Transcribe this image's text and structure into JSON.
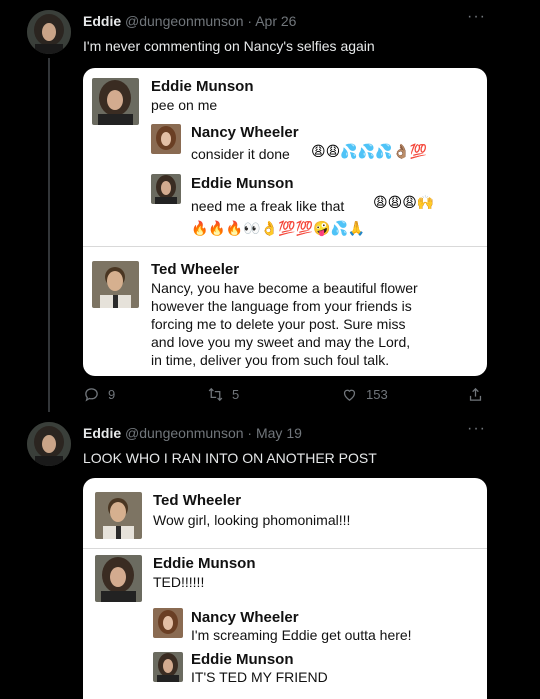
{
  "tweets": [
    {
      "author": "Eddie",
      "meta": "@dungeonmunson · Apr 26",
      "text": "I'm never commenting on Nancy's selfies again",
      "more": "···",
      "card": {
        "post": {
          "name": "Eddie Munson",
          "text": "pee on me"
        },
        "replies": [
          {
            "name": "Nancy Wheeler",
            "text": "consider it done",
            "emoji": "😩😩💦💦💦👌🏽💯"
          },
          {
            "name": "Eddie Munson",
            "text": "need me a freak like that",
            "emoji": "😩😩😩🙌",
            "emoji2": "🔥🔥🔥👀👌💯💯🤪💦🙏"
          }
        ],
        "ted": {
          "name": "Ted Wheeler",
          "lines": [
            "Nancy, you have become a beautiful flower",
            "however the language from your friends is",
            "forcing me to delete your post. Sure miss",
            "and love you my sweet and may the Lord,",
            "in time, deliver you from such foul talk."
          ]
        }
      },
      "actions": {
        "replies": "9",
        "retweets": "5",
        "likes": "153"
      }
    },
    {
      "author": "Eddie",
      "meta": "@dungeonmunson · May 19",
      "text": "LOOK WHO I RAN INTO ON ANOTHER POST",
      "more": "···",
      "card": {
        "ted": {
          "name": "Ted Wheeler",
          "text": "Wow girl, looking phomonimal!!!"
        },
        "eddie": {
          "name": "Eddie Munson",
          "text": "TED!!!!!!"
        },
        "nancy": {
          "name": "Nancy Wheeler",
          "text": "I'm screaming Eddie get outta here!"
        },
        "eddie2": {
          "name": "Eddie Munson",
          "text": "IT'S TED MY FRIEND"
        }
      }
    }
  ],
  "colors": {
    "background": "#000000",
    "text": "#e7e9ea",
    "secondary": "#71767b",
    "card": "#ffffff"
  }
}
